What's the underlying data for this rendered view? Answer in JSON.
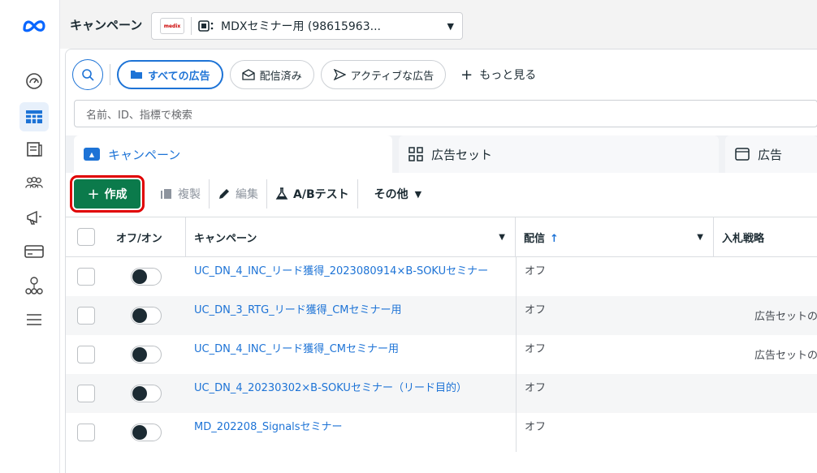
{
  "header": {
    "title": "キャンペーン",
    "account_badge": "medix",
    "account_name": "MDXセミナー用 (98615963..."
  },
  "filters": {
    "all_ads": "すべての広告",
    "delivered": "配信済み",
    "active_ads": "アクティブな広告",
    "more": "もっと見る"
  },
  "search": {
    "placeholder": "名前、ID、指標で検索"
  },
  "tabs": [
    {
      "label": "キャンペーン"
    },
    {
      "label": "広告セット"
    },
    {
      "label": "広告"
    }
  ],
  "toolbar": {
    "create": "作成",
    "duplicate": "複製",
    "edit": "編集",
    "ab_test": "A/Bテスト",
    "more": "その他"
  },
  "table": {
    "columns": [
      "オフ/オン",
      "キャンペーン",
      "配信",
      "入札戦略"
    ],
    "rows": [
      {
        "name": "UC_DN_4_INC_リード獲得_2023080914×B-SOKUセミナー",
        "delivery": "オフ",
        "bid": ""
      },
      {
        "name": "UC_DN_3_RTG_リード獲得_CMセミナー用",
        "delivery": "オフ",
        "bid": "広告セットの"
      },
      {
        "name": "UC_DN_4_INC_リード獲得_CMセミナー用",
        "delivery": "オフ",
        "bid": "広告セットの"
      },
      {
        "name": "UC_DN_4_20230302×B-SOKUセミナー（リード目的）",
        "delivery": "オフ",
        "bid": ""
      },
      {
        "name": "MD_202208_Signalsセミナー",
        "delivery": "オフ",
        "bid": ""
      }
    ]
  },
  "colors": {
    "accent": "#1d73d6",
    "create": "#0b7a4b",
    "highlight": "#e00000"
  }
}
